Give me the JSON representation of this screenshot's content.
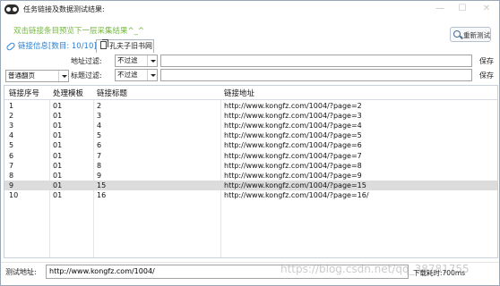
{
  "window": {
    "title": "任务链接及数据测试结果:",
    "controls": {
      "minimize": "—",
      "maximize": "☐",
      "close": "✕"
    }
  },
  "hint": "双击链接条目预览下一层采集结果^_^",
  "retest_button": "重新测试",
  "tabs": [
    {
      "label": "链接信息[数目: 10/10]",
      "icon": "link-icon",
      "active": true
    },
    {
      "label": "孔夫子旧书网",
      "icon": "document-icon",
      "active": false
    }
  ],
  "filters": {
    "mode_select": "普通翻页",
    "url_filter": {
      "label": "地址过滤:",
      "select": "不过滤",
      "value": "",
      "save": "保存"
    },
    "title_filter": {
      "label": "标题过滤:",
      "select": "不过滤",
      "value": "",
      "save": "保存"
    }
  },
  "table": {
    "columns": [
      "链接序号",
      "处理模板",
      "链接标题",
      "链接地址"
    ],
    "rows": [
      {
        "id": "1",
        "template": "01",
        "title": "2",
        "url": "http://www.kongfz.com/1004/?page=2"
      },
      {
        "id": "2",
        "template": "01",
        "title": "3",
        "url": "http://www.kongfz.com/1004/?page=3"
      },
      {
        "id": "3",
        "template": "01",
        "title": "4",
        "url": "http://www.kongfz.com/1004/?page=4"
      },
      {
        "id": "4",
        "template": "01",
        "title": "5",
        "url": "http://www.kongfz.com/1004/?page=5"
      },
      {
        "id": "5",
        "template": "01",
        "title": "6",
        "url": "http://www.kongfz.com/1004/?page=6"
      },
      {
        "id": "6",
        "template": "01",
        "title": "7",
        "url": "http://www.kongfz.com/1004/?page=7"
      },
      {
        "id": "7",
        "template": "01",
        "title": "8",
        "url": "http://www.kongfz.com/1004/?page=8"
      },
      {
        "id": "8",
        "template": "01",
        "title": "9",
        "url": "http://www.kongfz.com/1004/?page=9"
      },
      {
        "id": "9",
        "template": "01",
        "title": "15",
        "url": "http://www.kongfz.com/1004/?page=15",
        "selected": true
      },
      {
        "id": "10",
        "template": "01",
        "title": "16",
        "url": "http://www.kongfz.com/1004/?page=16/"
      }
    ]
  },
  "status": {
    "label": "测试地址:",
    "url": "http://www.kongfz.com/1004/",
    "elapsed": "下载耗时:700ms",
    "watermark": "https://blog.csdn.net/qq_38781755"
  }
}
